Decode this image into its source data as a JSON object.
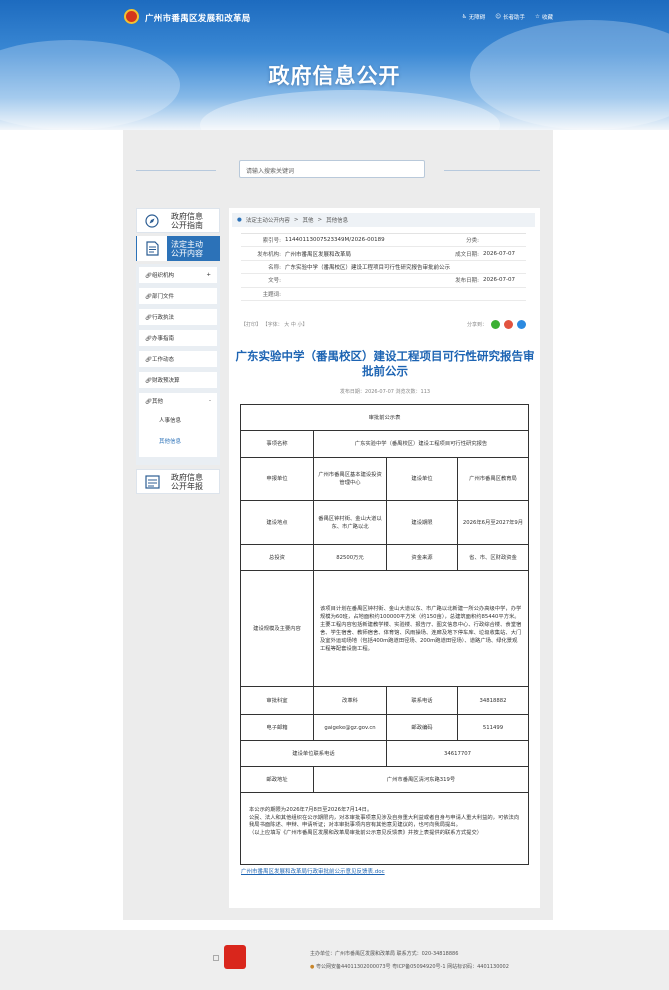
{
  "header": {
    "site_name": "广州市番禺区发展和改革局",
    "links": [
      "无障碍",
      "长者助手",
      "收藏"
    ],
    "banner_title": "政府信息公开"
  },
  "search": {
    "placeholder": "请输入搜索关键词"
  },
  "sidebar": {
    "heads": [
      {
        "label_line1": "政府信息",
        "label_line2": "公开指南",
        "icon": "compass-icon"
      },
      {
        "label_line1": "法定主动",
        "label_line2": "公开内容",
        "icon": "document-icon"
      },
      {
        "label_line1": "政府信息",
        "label_line2": "公开年报",
        "icon": "report-icon"
      }
    ],
    "items": [
      {
        "label": "组织机构",
        "mark": "+"
      },
      {
        "label": "部门文件",
        "mark": ""
      },
      {
        "label": "行政执法",
        "mark": ""
      },
      {
        "label": "办事指南",
        "mark": ""
      },
      {
        "label": "工作动态",
        "mark": ""
      },
      {
        "label": "财政预决算",
        "mark": ""
      },
      {
        "label": "其他",
        "mark": "-"
      }
    ],
    "sub_items": [
      "人事信息",
      "其他信息"
    ]
  },
  "breadcrumb": {
    "items": [
      "法定主动公开内容",
      "其他",
      "其他信息"
    ],
    "sep": ">"
  },
  "meta": {
    "index_label": "索引号:",
    "index_value": "11440113007523349M/2026-00189",
    "category_label": "分类:",
    "category_value": "",
    "publisher_label": "发布机构:",
    "publisher_value": "广州市番禺区发展和改革局",
    "created_label": "成文日期:",
    "created_value": "2026-07-07",
    "name_label": "名称:",
    "name_value": "广东实验中学（番禺校区）建设工程项目可行性研究报告审批前公示",
    "doc_label": "文号:",
    "doc_value": "",
    "published_label": "发布日期:",
    "published_value": "2026-07-07",
    "subject_label": "主题词:",
    "subject_value": ""
  },
  "tools": {
    "print": "【打印】",
    "fontsize": "【字体：",
    "font_large": "大",
    "font_medium": "中",
    "font_small": "小】",
    "share_label": "分享到："
  },
  "article": {
    "title": "广东实验中学（番禺校区）建设工程项目可行性研究报告审批前公示",
    "date_line": "发布日期：2026-07-07  浏览次数：113"
  },
  "notice_table": {
    "caption": "审批前公示表",
    "item_name_label": "事项名称",
    "item_name_value": "广东实验中学（番禺校区）建设工程项目可行性研究报告",
    "applicant_label": "申报单位",
    "applicant_value": "广州市番禺区基本建设投资管理中心",
    "builder_label": "建设单位",
    "builder_value": "广州市番禺区教育局",
    "location_label": "建设地点",
    "location_value": "番禺区钟村街、金山大道以东、市广路以北",
    "period_label": "建设期限",
    "period_value": "2026年6月至2027年9月",
    "invest_label": "总投资",
    "invest_value": "82500万元",
    "fund_label": "资金来源",
    "fund_value": "省、市、区财政资金",
    "scale_label": "建设规模及主要内容",
    "scale_value": "该项目计划在番禺区钟村街、金山大道以东、市广路以北新建一所公办高级中学，办学规模为60班，占地面积约100000平方米（约150亩），总建筑面积约85440平方米。主要工程内容包括新建教学楼、实验楼、报告厅、图文信息中心、行政综合楼、食堂宿舍、学生宿舍、教师宿舍、体育馆、风雨操场、连廊及地下停车库、垃圾收集站、大门及室外运动场地（包括400m跑道田径场、200m跑道田径场）、道路广场、绿化景观工程等配套设施工程。",
    "approve_label": "审批科室",
    "approve_value": "改革科",
    "phone_label": "联系电话",
    "phone_value": "34818882",
    "email_label": "电子邮箱",
    "email_value": "gaigeke@gz.gov.cn",
    "zip_label": "邮政编码",
    "zip_value": "511499",
    "builder_phone_label": "建设单位联系电话",
    "builder_phone_value": "34617707",
    "address_label": "邮政地址",
    "address_value": "广州市番禺区清河东路319号"
  },
  "note": {
    "line1": "本公示的期限为2026年7月8日至2026年7月14日。",
    "line2": "公民、法人和其他组织在公示期限内，对本审批事项意见涉及自身重大利益或者自身与申请人重大利益的，可依法向我局书面陈述、申辩、申请听证；对本审批事项内容有其他意见建议的，也可向我局提出。",
    "line3": "（以上应填写《广州市番禺区发展和改革局审批前公示意见反馈表》并按上表提供的联系方式提交）",
    "link": "广州市番禺区发展和改革局行政审批前公示意见反馈表.doc"
  },
  "footer": {
    "host": "主办单位：广州市番禺区发展和改革局    联系方式：020-34818886",
    "record": "粤公网安备44011302000073号 粤ICP备05094920号-1 网站标识码：4401130002"
  }
}
